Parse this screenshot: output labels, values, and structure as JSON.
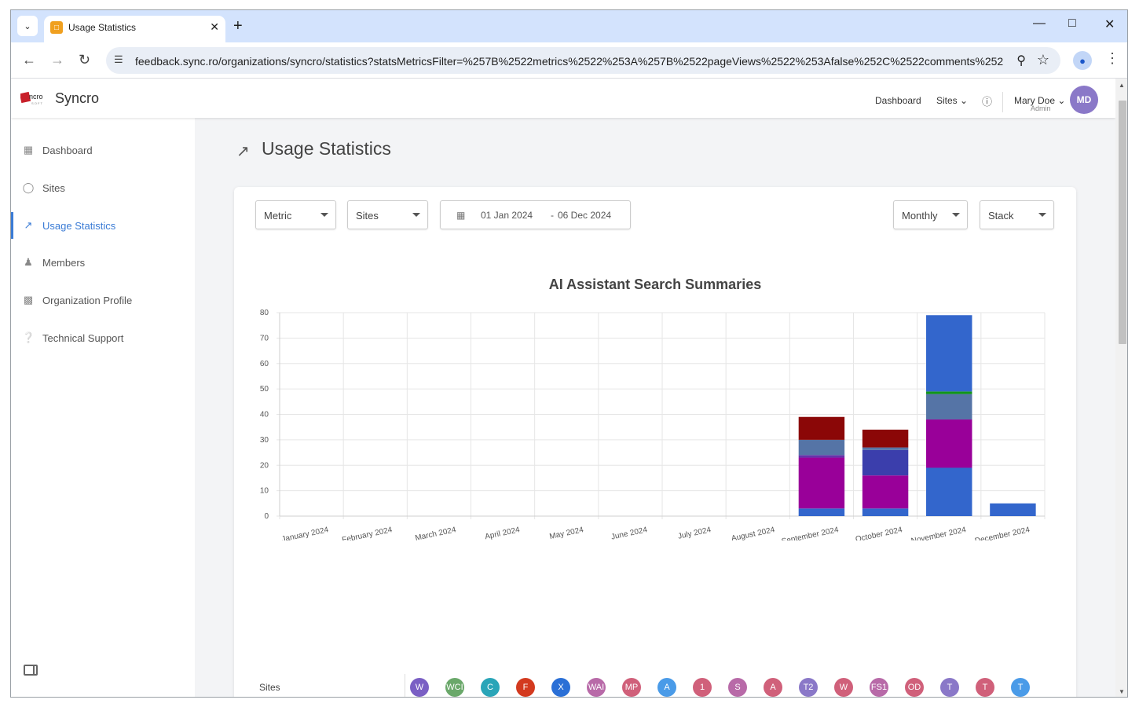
{
  "browser": {
    "tab_title": "Usage Statistics",
    "url": "feedback.sync.ro/organizations/syncro/statistics?statsMetricsFilter=%257B%2522metrics%2522%253A%257B%2522pageViews%2522%253Afalse%252C%2522comments%2522%…"
  },
  "app": {
    "logo_text": "Syncro",
    "topnav": {
      "dashboard": "Dashboard",
      "sites": "Sites"
    },
    "user": {
      "name": "Mary Doe",
      "role": "Admin",
      "initials": "MD"
    }
  },
  "sidebar": {
    "items": [
      {
        "label": "Dashboard",
        "icon": "dashboard-icon"
      },
      {
        "label": "Sites",
        "icon": "sites-icon"
      },
      {
        "label": "Usage Statistics",
        "icon": "trending-icon",
        "active": true
      },
      {
        "label": "Members",
        "icon": "members-icon"
      },
      {
        "label": "Organization Profile",
        "icon": "building-icon"
      },
      {
        "label": "Technical Support",
        "icon": "help-icon"
      }
    ]
  },
  "page": {
    "title": "Usage Statistics"
  },
  "filters": {
    "metric": "Metric",
    "sites": "Sites",
    "date_from": "01 Jan 2024",
    "date_sep": "-",
    "date_to": "06 Dec 2024",
    "period": "Monthly",
    "mode": "Stack"
  },
  "chart_data": {
    "type": "bar",
    "stacked": true,
    "title": "AI Assistant Search Summaries",
    "categories": [
      "January 2024",
      "February 2024",
      "March 2024",
      "April 2024",
      "May 2024",
      "June 2024",
      "July 2024",
      "August 2024",
      "September 2024",
      "October 2024",
      "November 2024",
      "December 2024"
    ],
    "ylim": [
      0,
      80
    ],
    "yticks": [
      0,
      10,
      20,
      30,
      40,
      50,
      60,
      70,
      80
    ],
    "grid": true,
    "series": [
      {
        "color": "#3366cc",
        "values": [
          0,
          0,
          0,
          0,
          0,
          0,
          0,
          0,
          3,
          3,
          19,
          5
        ]
      },
      {
        "color": "#990099",
        "values": [
          0,
          0,
          0,
          0,
          0,
          0,
          0,
          0,
          20,
          13,
          19,
          0
        ]
      },
      {
        "color": "#6633aa",
        "values": [
          0,
          0,
          0,
          0,
          0,
          0,
          0,
          0,
          1,
          0,
          0,
          0
        ]
      },
      {
        "color": "#3b3eac",
        "values": [
          0,
          0,
          0,
          0,
          0,
          0,
          0,
          0,
          0,
          10,
          0,
          0
        ]
      },
      {
        "color": "#5574a6",
        "values": [
          0,
          0,
          0,
          0,
          0,
          0,
          0,
          0,
          6,
          1,
          10,
          0
        ]
      },
      {
        "color": "#109618",
        "values": [
          0,
          0,
          0,
          0,
          0,
          0,
          0,
          0,
          0,
          0,
          1,
          0
        ]
      },
      {
        "color": "#8b0707",
        "values": [
          0,
          0,
          0,
          0,
          0,
          0,
          0,
          0,
          9,
          7,
          0,
          0
        ]
      },
      {
        "color": "#3366cc",
        "values": [
          0,
          0,
          0,
          0,
          0,
          0,
          0,
          0,
          0,
          0,
          30,
          0
        ]
      }
    ]
  },
  "sites_row": {
    "label": "Sites",
    "badges": [
      {
        "text": "W",
        "color": "#7a5fc4"
      },
      {
        "text": "WCI",
        "color": "#6aa86a"
      },
      {
        "text": "C",
        "color": "#2aa5b8"
      },
      {
        "text": "F",
        "color": "#d33a1f"
      },
      {
        "text": "X",
        "color": "#2a6fd6"
      },
      {
        "text": "WAI",
        "color": "#b86aa8"
      },
      {
        "text": "MP",
        "color": "#d0607a"
      },
      {
        "text": "A",
        "color": "#4a9be8"
      },
      {
        "text": "1",
        "color": "#d0607a"
      },
      {
        "text": "S",
        "color": "#b86aa8"
      },
      {
        "text": "A",
        "color": "#d0607a"
      },
      {
        "text": "T2",
        "color": "#8a78c8"
      },
      {
        "text": "W",
        "color": "#d0607a"
      },
      {
        "text": "FS1",
        "color": "#b86aa8"
      },
      {
        "text": "OD",
        "color": "#d0607a"
      },
      {
        "text": "T",
        "color": "#8a78c8"
      },
      {
        "text": "T",
        "color": "#d0607a"
      },
      {
        "text": "T",
        "color": "#4a9be8"
      }
    ]
  }
}
